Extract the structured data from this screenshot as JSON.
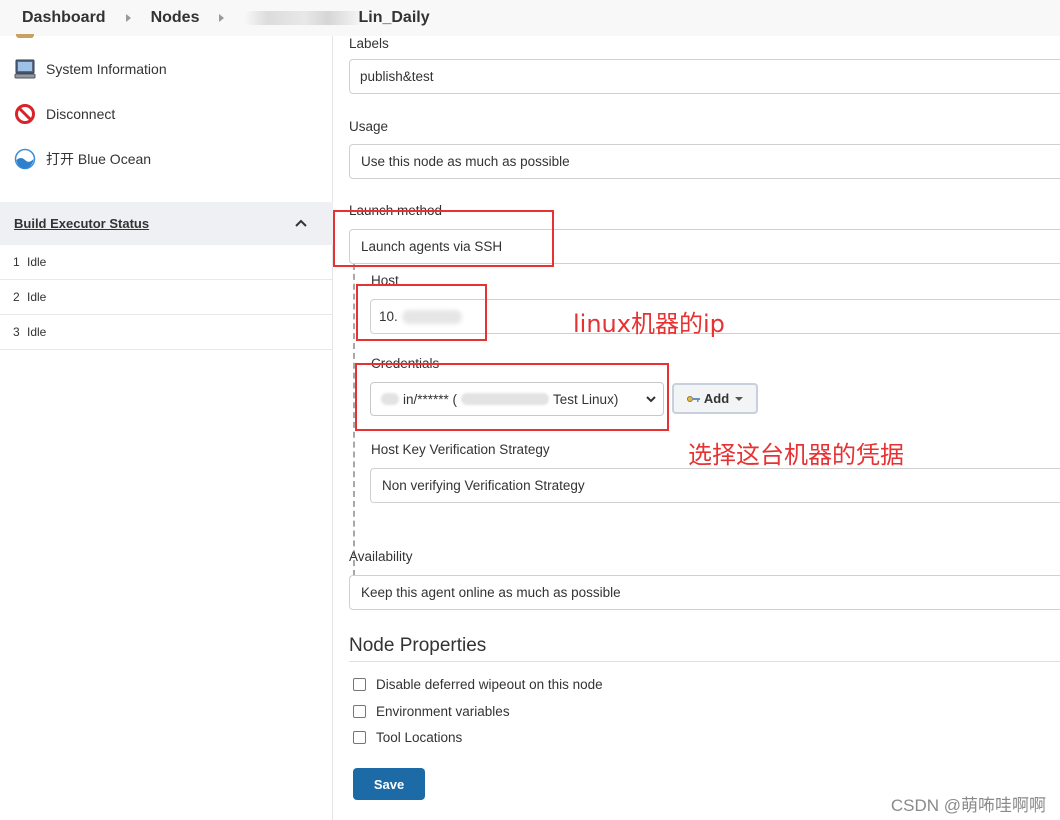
{
  "breadcrumb": {
    "items": [
      "Dashboard",
      "Nodes"
    ],
    "current": "Lin_Daily"
  },
  "sidebar": {
    "links": [
      {
        "label": "System Information",
        "icon": "computer-icon"
      },
      {
        "label": "Disconnect",
        "icon": "disconnect-icon"
      },
      {
        "label": "打开 Blue Ocean",
        "icon": "blue-ocean-icon"
      }
    ],
    "executor_status": {
      "title": "Build Executor Status",
      "rows": [
        {
          "num": "1",
          "status": "Idle"
        },
        {
          "num": "2",
          "status": "Idle"
        },
        {
          "num": "3",
          "status": "Idle"
        }
      ]
    }
  },
  "form": {
    "labels_label": "Labels",
    "labels_value": "publish&test",
    "usage_label": "Usage",
    "usage_value": "Use this node as much as possible",
    "launch_label": "Launch method",
    "launch_value": "Launch agents via SSH",
    "host_label": "Host",
    "host_value": "10.",
    "credentials_label": "Credentials",
    "credentials_value_prefix": "in/****** (",
    "credentials_value_suffix": "Test Linux)",
    "add_button": "Add",
    "host_key_label": "Host Key Verification Strategy",
    "host_key_value": "Non verifying Verification Strategy",
    "availability_label": "Availability",
    "availability_value": "Keep this agent online as much as possible",
    "node_properties_title": "Node Properties",
    "checkboxes": [
      "Disable deferred wipeout on this node",
      "Environment variables",
      "Tool Locations"
    ],
    "save_button": "Save"
  },
  "annotations": {
    "ip_note": "linux机器的ip",
    "cred_note": "选择这台机器的凭据",
    "color": "#e63232"
  },
  "watermark": "CSDN @萌咘哇啊啊",
  "colors": {
    "save_button": "#1c6ba7",
    "breadcrumb_bg": "#f8f8f8",
    "executor_header_bg": "#eef0f3"
  }
}
